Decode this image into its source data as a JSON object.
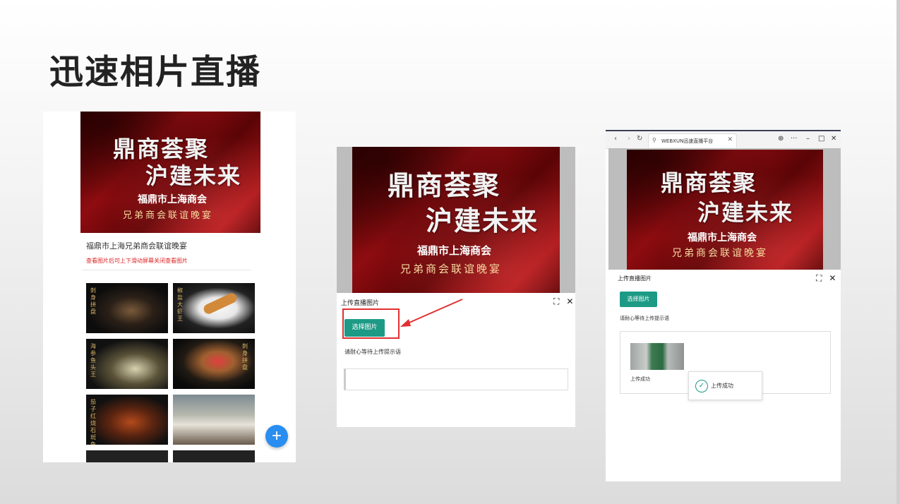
{
  "slide": {
    "title": "迅速相片直播"
  },
  "banner": {
    "calli_line1": "鼎商荟聚",
    "calli_line2": "沪建未来",
    "org": "福鼎市上海商会",
    "sub": "兄弟商会联谊晚宴"
  },
  "mobile": {
    "event_title": "福鼎市上海兄弟商会联谊晚宴",
    "hint": "查看图片后可上下滑动屏幕关闭查看图片",
    "fab_icon": "plus-icon",
    "fab_label": "+",
    "fab_color": "#2a8ef0",
    "photos": [
      {
        "name": "sashimi-platter",
        "caption": "刺身拼盘"
      },
      {
        "name": "fried-dish",
        "caption": "椒盐大虾王"
      },
      {
        "name": "fish-soup",
        "caption": "海参鱼头王"
      },
      {
        "name": "sashimi-platter-2",
        "caption": "刺身拼盘"
      },
      {
        "name": "braised-pot",
        "caption": "茄子红烧石斑鱼"
      },
      {
        "name": "banquet-room",
        "caption": ""
      },
      {
        "name": "dish-7",
        "caption": ""
      },
      {
        "name": "dish-8",
        "caption": ""
      }
    ]
  },
  "upload_dialog": {
    "title": "上传直播图片",
    "select_button": "选择图片",
    "wait_text": "请耐心等待上传提示语",
    "expand_icon": "⛶",
    "close_icon": "✕",
    "accent_color": "#1d9a86",
    "highlight_color": "#e13030"
  },
  "browser": {
    "tab_title": "WEBXUN迅速直播平台",
    "back": "‹",
    "forward": "›",
    "reload": "↻",
    "tab_icon": "⚲",
    "tab_close": "✕",
    "globe": "⊕",
    "more": "···",
    "minimize": "–",
    "maximize": "□",
    "close": "✕"
  },
  "upload_result": {
    "thumb_label": "上传成功",
    "toast_text": "上传成功",
    "toast_icon": "✓"
  }
}
